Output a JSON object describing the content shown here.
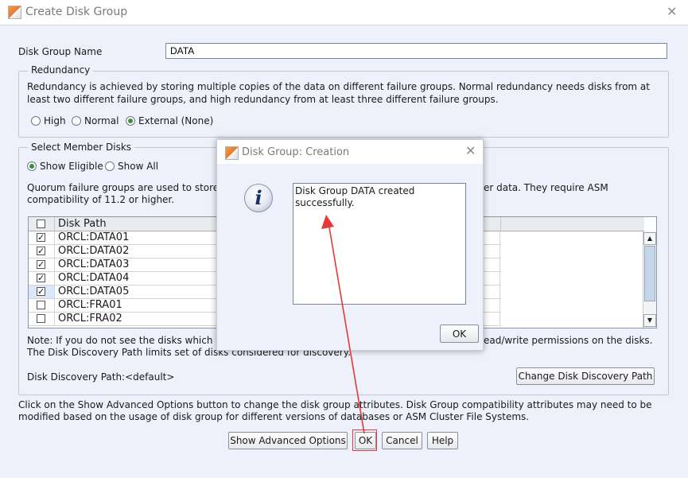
{
  "window": {
    "title": "Create Disk Group",
    "close_glyph": "✕"
  },
  "disk_group_name": {
    "label": "Disk Group Name",
    "value": "DATA"
  },
  "redundancy": {
    "legend": "Redundancy",
    "description": "Redundancy is achieved by storing multiple copies of the data on different failure groups. Normal redundancy needs disks from at least two different failure groups, and high redundancy from at least three different failure groups.",
    "options": [
      {
        "label": "High",
        "selected": false
      },
      {
        "label": "Normal",
        "selected": false
      },
      {
        "label": "External (None)",
        "selected": true
      }
    ]
  },
  "member_disks": {
    "legend": "Select Member Disks",
    "filters": [
      {
        "label": "Show Eligible",
        "selected": true
      },
      {
        "label": "Show All",
        "selected": false
      }
    ],
    "quorum_text_left": "Quorum failure groups are used to store",
    "quorum_text_right": "er data. They require ASM",
    "quorum_text_line2": "compatibility of 11.2 or higher.",
    "table": {
      "column_path": "Disk Path",
      "rows": [
        {
          "path": "ORCL:DATA01",
          "checked": true
        },
        {
          "path": "ORCL:DATA02",
          "checked": true
        },
        {
          "path": "ORCL:DATA03",
          "checked": true
        },
        {
          "path": "ORCL:DATA04",
          "checked": true
        },
        {
          "path": "ORCL:DATA05",
          "checked": true
        },
        {
          "path": "ORCL:FRA01",
          "checked": false
        },
        {
          "path": "ORCL:FRA02",
          "checked": false
        }
      ]
    },
    "note_left": "Note: If you do not see the disks which yo",
    "note_right": "ead/write permissions on the disks.",
    "note_line2": "The Disk Discovery Path limits set of disks considered for discovery.",
    "discovery_path_label": "Disk Discovery Path:<default>",
    "change_path_button": "Change Disk Discovery Path"
  },
  "advanced_text": "Click on the Show Advanced Options button to change the disk group attributes. Disk Group compatibility attributes may need to be modified based on the usage of disk group for different versions of databases or ASM Cluster File Systems.",
  "buttons": {
    "advanced": "Show Advanced Options",
    "ok": "OK",
    "cancel": "Cancel",
    "help": "Help"
  },
  "dialog": {
    "title": "Disk Group: Creation",
    "close_glyph": "✕",
    "info_glyph": "i",
    "message": "Disk Group DATA created successfully.",
    "ok": "OK"
  },
  "colors": {
    "annotation_red": "#e53935",
    "accent_green": "#3a8f3a"
  }
}
